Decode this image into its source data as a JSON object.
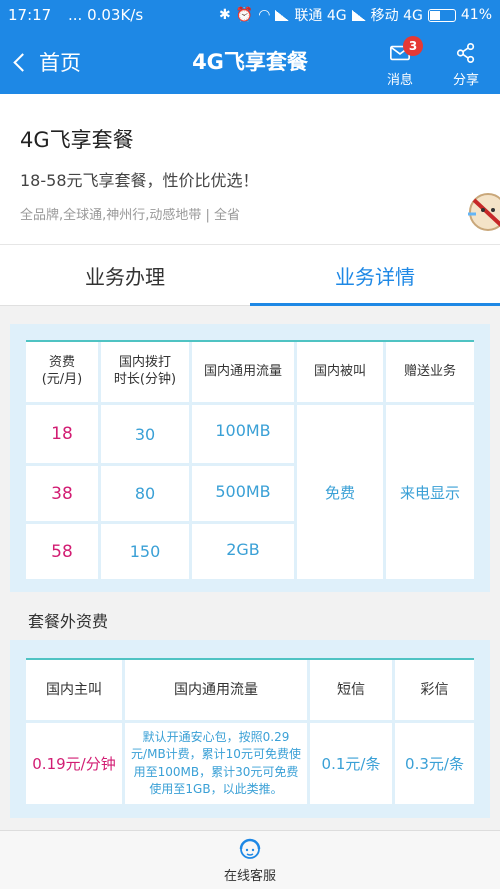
{
  "status_bar": {
    "time": "17:17",
    "speed": "... 0.03K/s",
    "carrier1": "联通 4G",
    "carrier2": "移动 4G",
    "battery": "41%"
  },
  "nav": {
    "back_label": "首页",
    "title": "4G飞享套餐",
    "messages_label": "消息",
    "messages_badge": "3",
    "share_label": "分享"
  },
  "plan": {
    "title": "4G飞享套餐",
    "subtitle": "18-58元飞享套餐，性价比优选！",
    "meta": "全品牌,全球通,神州行,动感地带  |  全省"
  },
  "tabs": [
    {
      "label": "业务办理",
      "active": false
    },
    {
      "label": "业务详情",
      "active": true
    }
  ],
  "table1": {
    "headers": [
      "资费\n(元/月)",
      "国内拨打\n时长(分钟)",
      "国内通用流量",
      "国内被叫",
      "赠送业务"
    ],
    "rows": [
      {
        "fee": "18",
        "minutes": "30",
        "data": "100MB"
      },
      {
        "fee": "38",
        "minutes": "80",
        "data": "500MB"
      },
      {
        "fee": "58",
        "minutes": "150",
        "data": "2GB"
      }
    ],
    "incoming": "免费",
    "bonus": "来电显示"
  },
  "extra": {
    "section_title": "套餐外资费",
    "headers": [
      "国内主叫",
      "国内通用流量",
      "短信",
      "彩信"
    ],
    "row": {
      "call": "0.19元/分钟",
      "data": "默认开通安心包，按照0.29元/MB计费，累计10元可免费使用至100MB，累计30元可免费使用至1GB，以此类推。",
      "sms": "0.1元/条",
      "mms": "0.3元/条"
    }
  },
  "footer": {
    "label": "在线客服"
  },
  "colors": {
    "primary": "#1e88e5",
    "fee": "#d21d73",
    "value": "#3aa0d6",
    "panel": "#dff0fa",
    "accent_line": "#4fc3c3"
  }
}
